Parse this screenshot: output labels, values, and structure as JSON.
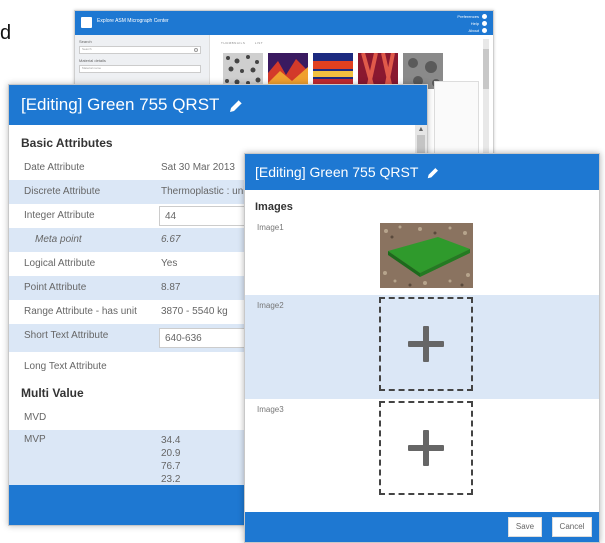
{
  "stray_text": "d",
  "background_app": {
    "title": "Explore ASM Micrograph Center",
    "menu": [
      "Preferences",
      "Help",
      "About"
    ],
    "sidebar": {
      "search_label": "Search",
      "search_placeholder": "Search",
      "material_label": "Material details",
      "material_placeholder": "Material name"
    },
    "tabs": [
      "THUMBNAILS",
      "LIST"
    ]
  },
  "dialog1": {
    "title": "[Editing]  Green 755 QRST",
    "basic_section": "Basic Attributes",
    "rows": [
      {
        "label": "Date Attribute",
        "value": "Sat 30 Mar 2013"
      },
      {
        "label": "Discrete Attribute",
        "value": "Thermoplastic : uni"
      },
      {
        "label": "Integer Attribute",
        "value": "44"
      },
      {
        "label": "Meta point",
        "value": "6.67"
      },
      {
        "label": "Logical Attribute",
        "value": "Yes"
      },
      {
        "label": "Point Attribute",
        "value": "8.87"
      },
      {
        "label": "Range Attribute - has unit",
        "value": "3870 - 5540 kg"
      },
      {
        "label": "Short Text Attribute",
        "value": "640-636"
      },
      {
        "label": "Long Text Attribute",
        "value": ""
      }
    ],
    "multi_section": "Multi Value",
    "mvd_label": "MVD",
    "mvp_label": "MVP",
    "mvp_values": [
      "34.4",
      "20.9",
      "76.7",
      "23.2"
    ]
  },
  "dialog2": {
    "title": "[Editing]  Green 755 QRST",
    "images_section": "Images",
    "images": [
      {
        "label": "Image1",
        "state": "photo"
      },
      {
        "label": "Image2",
        "state": "empty"
      },
      {
        "label": "Image3",
        "state": "empty"
      }
    ],
    "save_label": "Save",
    "cancel_label": "Cancel"
  },
  "colors": {
    "accent": "#1e78d2",
    "row_highlight": "#dbe7f6",
    "swatch_green": "#2f9a2c"
  }
}
